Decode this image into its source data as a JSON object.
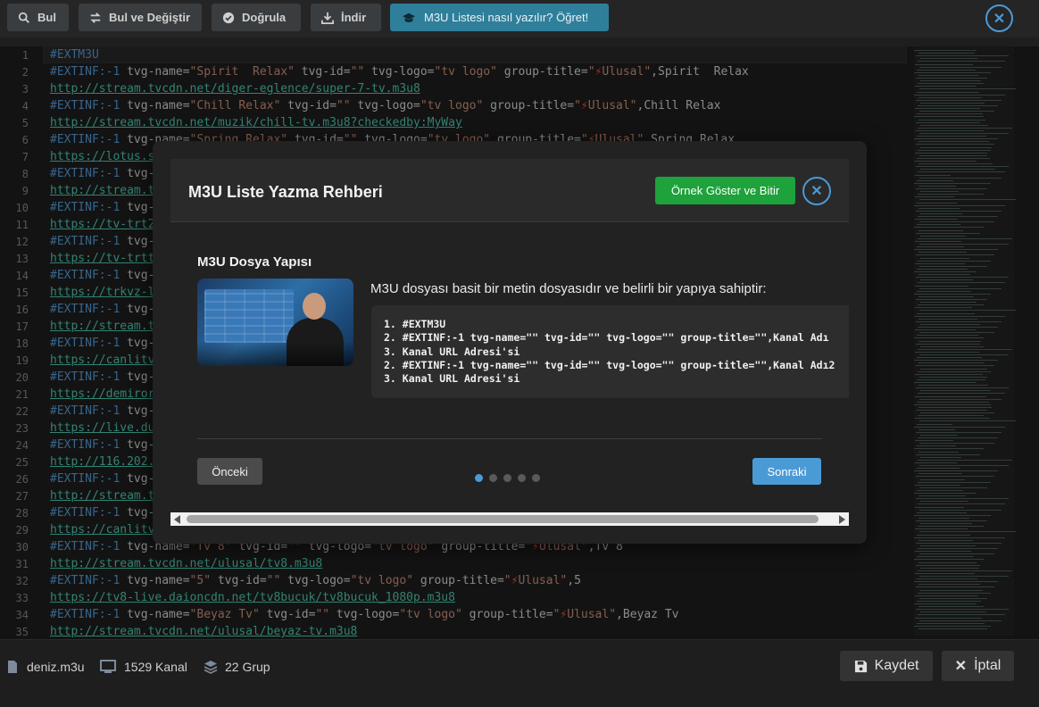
{
  "toolbar": {
    "find": "Bul",
    "find_replace": "Bul ve Değiştir",
    "validate": "Doğrula",
    "download": "İndir",
    "learn": "M3U Listesi nasıl yazılır? Öğret!"
  },
  "editor": {
    "lines": [
      {
        "n": "1",
        "parts": [
          [
            "kw",
            "#EXTM3U"
          ]
        ]
      },
      {
        "n": "2",
        "parts": [
          [
            "kw",
            "#EXTINF:-1 "
          ],
          [
            "",
            "tvg-name="
          ],
          [
            "str",
            "\"Spirit  Relax\""
          ],
          [
            "",
            " tvg-id="
          ],
          [
            "str",
            "\"\""
          ],
          [
            "",
            " tvg-logo="
          ],
          [
            "str",
            "\"tv logo\""
          ],
          [
            "",
            " group-title="
          ],
          [
            "str",
            "\""
          ],
          [
            "bolt",
            "⚡"
          ],
          [
            "str",
            "Ulusal\""
          ],
          [
            "",
            ",Spirit  Relax"
          ]
        ]
      },
      {
        "n": "3",
        "parts": [
          [
            "url",
            "http://stream.tvcdn.net/diger-eglence/super-7-tv.m3u8"
          ]
        ]
      },
      {
        "n": "4",
        "parts": [
          [
            "kw",
            "#EXTINF:-1 "
          ],
          [
            "",
            "tvg-name="
          ],
          [
            "str",
            "\"Chill Relax\""
          ],
          [
            "",
            " tvg-id="
          ],
          [
            "str",
            "\"\""
          ],
          [
            "",
            " tvg-logo="
          ],
          [
            "str",
            "\"tv logo\""
          ],
          [
            "",
            " group-title="
          ],
          [
            "str",
            "\""
          ],
          [
            "bolt",
            "⚡"
          ],
          [
            "str",
            "Ulusal\""
          ],
          [
            "",
            ",Chill Relax"
          ]
        ]
      },
      {
        "n": "5",
        "parts": [
          [
            "url",
            "http://stream.tvcdn.net/muzik/chill-tv.m3u8?checkedby:MyWay"
          ]
        ]
      },
      {
        "n": "6",
        "parts": [
          [
            "kw",
            "#EXTINF:-1 "
          ],
          [
            "",
            "tvg-name="
          ],
          [
            "str",
            "\"Spring Relax\""
          ],
          [
            "",
            " tvg-id="
          ],
          [
            "str",
            "\"\""
          ],
          [
            "",
            " tvg-logo="
          ],
          [
            "str",
            "\"tv logo\""
          ],
          [
            "",
            " group-title="
          ],
          [
            "str",
            "\""
          ],
          [
            "bolt",
            "⚡"
          ],
          [
            "str",
            "Ulusal\""
          ],
          [
            "",
            ",Spring Relax"
          ]
        ]
      },
      {
        "n": "7",
        "parts": [
          [
            "url",
            "https://lotus.s"
          ]
        ]
      },
      {
        "n": "8",
        "parts": [
          [
            "kw",
            "#EXTINF:-1 "
          ],
          [
            "",
            "tvg-"
          ]
        ]
      },
      {
        "n": "9",
        "parts": [
          [
            "url",
            "http://stream.t"
          ]
        ]
      },
      {
        "n": "10",
        "parts": [
          [
            "kw",
            "#EXTINF:-1 "
          ],
          [
            "",
            "tvg-"
          ]
        ]
      },
      {
        "n": "11",
        "parts": [
          [
            "url",
            "https://tv-trt2"
          ]
        ]
      },
      {
        "n": "12",
        "parts": [
          [
            "kw",
            "#EXTINF:-1 "
          ],
          [
            "",
            "tvg-"
          ]
        ]
      },
      {
        "n": "13",
        "parts": [
          [
            "url",
            "https://tv-trtt"
          ]
        ]
      },
      {
        "n": "14",
        "parts": [
          [
            "kw",
            "#EXTINF:-1 "
          ],
          [
            "",
            "tvg-"
          ]
        ]
      },
      {
        "n": "15",
        "parts": [
          [
            "url",
            "https://trkvz-l"
          ]
        ]
      },
      {
        "n": "16",
        "parts": [
          [
            "kw",
            "#EXTINF:-1 "
          ],
          [
            "",
            "tvg-"
          ]
        ]
      },
      {
        "n": "17",
        "parts": [
          [
            "url",
            "http://stream.t"
          ]
        ]
      },
      {
        "n": "18",
        "parts": [
          [
            "kw",
            "#EXTINF:-1 "
          ],
          [
            "",
            "tvg-"
          ]
        ]
      },
      {
        "n": "19",
        "parts": [
          [
            "url",
            "https://canlitv"
          ]
        ]
      },
      {
        "n": "20",
        "parts": [
          [
            "kw",
            "#EXTINF:-1 "
          ],
          [
            "",
            "tvg-"
          ]
        ]
      },
      {
        "n": "21",
        "parts": [
          [
            "url",
            "https://demiror"
          ]
        ]
      },
      {
        "n": "22",
        "parts": [
          [
            "kw",
            "#EXTINF:-1 "
          ],
          [
            "",
            "tvg-"
          ]
        ]
      },
      {
        "n": "23",
        "parts": [
          [
            "url",
            "https://live.du"
          ]
        ]
      },
      {
        "n": "24",
        "parts": [
          [
            "kw",
            "#EXTINF:-1 "
          ],
          [
            "",
            "tvg-"
          ]
        ]
      },
      {
        "n": "25",
        "parts": [
          [
            "url",
            "http://116.202."
          ]
        ]
      },
      {
        "n": "26",
        "parts": [
          [
            "kw",
            "#EXTINF:-1 "
          ],
          [
            "",
            "tvg-"
          ]
        ]
      },
      {
        "n": "27",
        "parts": [
          [
            "url",
            "http://stream.t"
          ]
        ]
      },
      {
        "n": "28",
        "parts": [
          [
            "kw",
            "#EXTINF:-1 "
          ],
          [
            "",
            "tvg-"
          ]
        ]
      },
      {
        "n": "29",
        "parts": [
          [
            "url",
            "https://canlitv"
          ]
        ]
      },
      {
        "n": "30",
        "parts": [
          [
            "kw",
            "#EXTINF:-1 "
          ],
          [
            "",
            "tvg-name="
          ],
          [
            "str",
            "\"Tv 8\""
          ],
          [
            "",
            " tvg-id="
          ],
          [
            "str",
            "\"\""
          ],
          [
            "",
            " tvg-logo="
          ],
          [
            "str",
            "\"tv logo\""
          ],
          [
            "",
            " group-title="
          ],
          [
            "str",
            "\""
          ],
          [
            "bolt",
            "⚡"
          ],
          [
            "str",
            "Ulusal\""
          ],
          [
            "",
            ",Tv 8"
          ]
        ]
      },
      {
        "n": "31",
        "parts": [
          [
            "url",
            "http://stream.tvcdn.net/ulusal/tv8.m3u8"
          ]
        ]
      },
      {
        "n": "32",
        "parts": [
          [
            "kw",
            "#EXTINF:-1 "
          ],
          [
            "",
            "tvg-name="
          ],
          [
            "str",
            "\"5\""
          ],
          [
            "",
            " tvg-id="
          ],
          [
            "str",
            "\"\""
          ],
          [
            "",
            " tvg-logo="
          ],
          [
            "str",
            "\"tv logo\""
          ],
          [
            "",
            " group-title="
          ],
          [
            "str",
            "\""
          ],
          [
            "bolt",
            "⚡"
          ],
          [
            "str",
            "Ulusal\""
          ],
          [
            "",
            ",5"
          ]
        ]
      },
      {
        "n": "33",
        "parts": [
          [
            "url",
            "https://tv8-live.daioncdn.net/tv8bucuk/tv8bucuk_1080p.m3u8"
          ]
        ]
      },
      {
        "n": "34",
        "parts": [
          [
            "kw",
            "#EXTINF:-1 "
          ],
          [
            "",
            "tvg-name="
          ],
          [
            "str",
            "\"Beyaz Tv\""
          ],
          [
            "",
            " tvg-id="
          ],
          [
            "str",
            "\"\""
          ],
          [
            "",
            " tvg-logo="
          ],
          [
            "str",
            "\"tv logo\""
          ],
          [
            "",
            " group-title="
          ],
          [
            "str",
            "\""
          ],
          [
            "bolt",
            "⚡"
          ],
          [
            "str",
            "Ulusal\""
          ],
          [
            "",
            ",Beyaz Tv"
          ]
        ]
      },
      {
        "n": "35",
        "parts": [
          [
            "url",
            "http://stream.tvcdn.net/ulusal/beyaz-tv.m3u8"
          ]
        ]
      }
    ]
  },
  "modal": {
    "title": "M3U Liste Yazma Rehberi",
    "example_button": "Örnek Göster ve Bitir",
    "section_title": "M3U Dosya Yapısı",
    "intro": "M3U dosyası basit bir metin dosyasıdır ve belirli bir yapıya sahiptir:",
    "code_lines": [
      "1. #EXTM3U",
      "2. #EXTINF:-1 tvg-name=\"\" tvg-id=\"\" tvg-logo=\"\" group-title=\"\",Kanal Adı",
      "3. Kanal URL Adresi'si",
      "2. #EXTINF:-1 tvg-name=\"\" tvg-id=\"\" tvg-logo=\"\" group-title=\"\",Kanal Adı2",
      "3. Kanal URL Adresi'si"
    ],
    "prev": "Önceki",
    "next": "Sonraki",
    "steps_total": 5,
    "step_current": 1
  },
  "footer": {
    "filename": "deniz.m3u",
    "channels": "1529 Kanal",
    "groups": "22 Grup",
    "save": "Kaydet",
    "cancel": "İptal"
  },
  "colors": {
    "accent": "#4a9ad6",
    "success": "#1ea23b",
    "keyword": "#569cd6",
    "string": "#ce9178",
    "url": "#4ec9b0"
  }
}
